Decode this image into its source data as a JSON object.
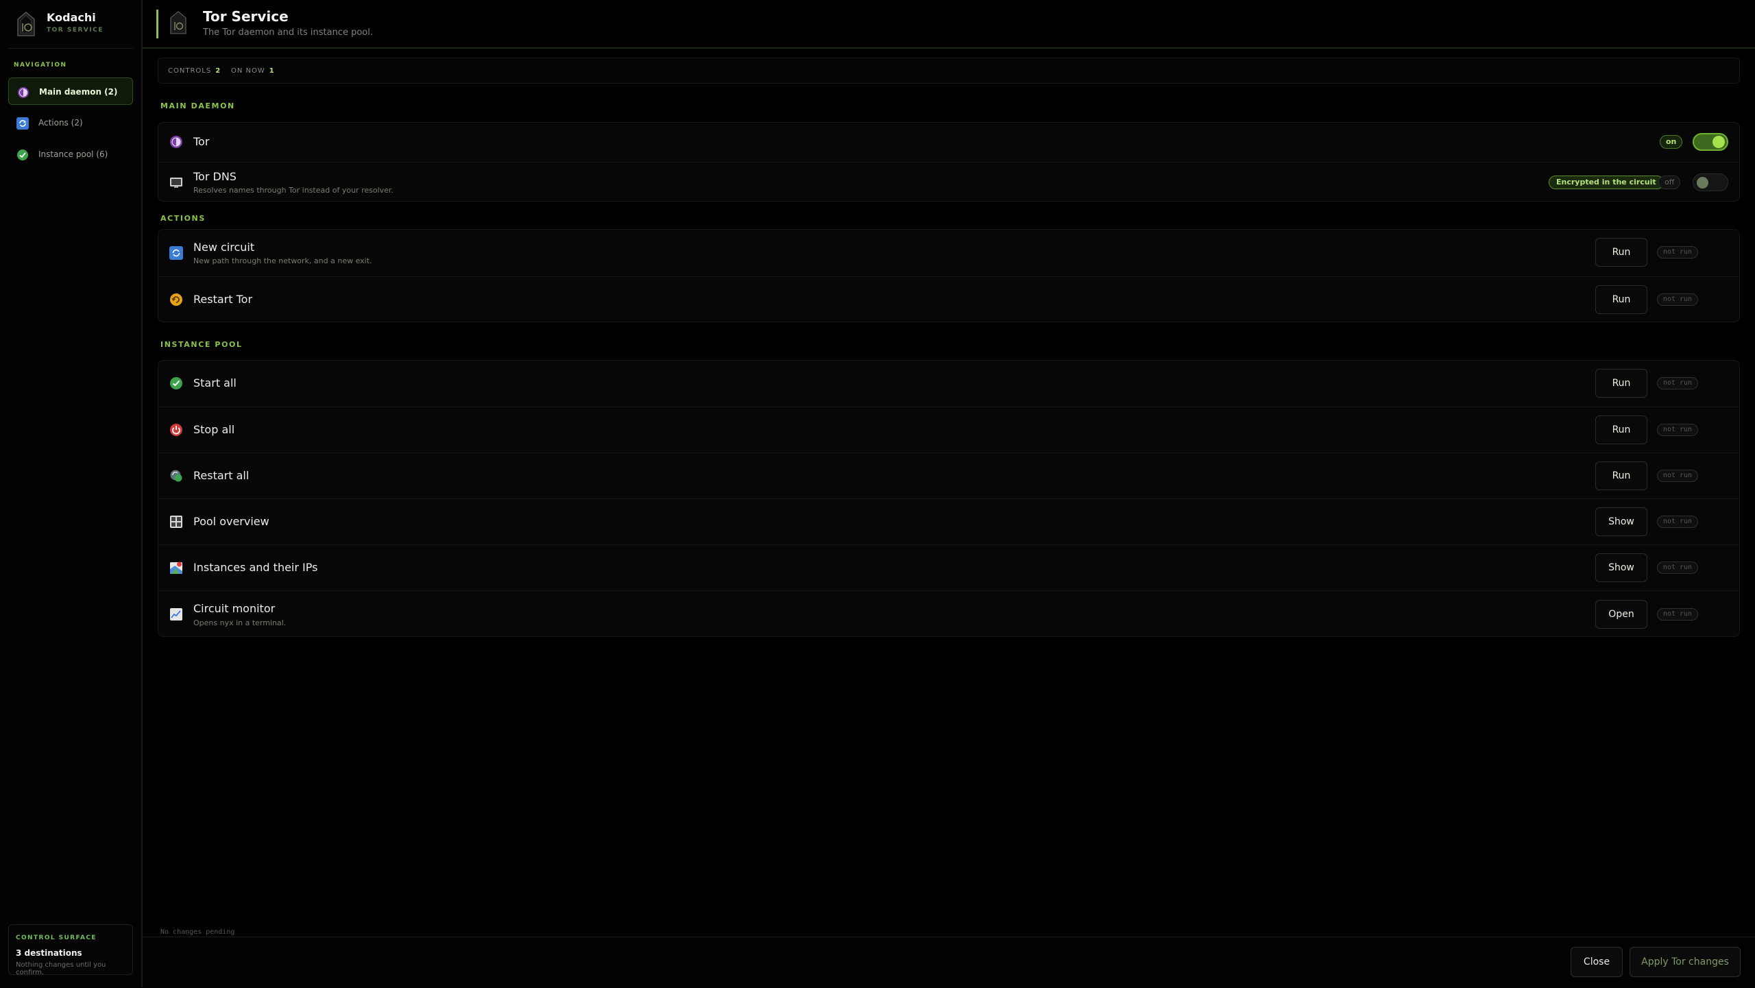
{
  "app": {
    "name": "Kodachi",
    "subtitle": "TOR SERVICE"
  },
  "sidebar": {
    "nav_heading": "NAVIGATION",
    "items": [
      {
        "label": "Main daemon (2)",
        "icon": "tor-onion-icon",
        "active": true
      },
      {
        "label": "Actions (2)",
        "icon": "refresh-icon",
        "active": false
      },
      {
        "label": "Instance pool (6)",
        "icon": "check-circle-icon",
        "active": false
      }
    ],
    "surface": {
      "heading": "CONTROL SURFACE",
      "title": "3 destinations",
      "note": "Nothing changes until you confirm."
    }
  },
  "header": {
    "title": "Tor Service",
    "subtitle": "The Tor daemon and its instance pool."
  },
  "summary": {
    "controls_label": "CONTROLS",
    "controls_value": "2",
    "on_label": "ON NOW",
    "on_value": "1"
  },
  "sections": {
    "main": {
      "heading": "MAIN DAEMON",
      "rows": [
        {
          "label": "Tor",
          "desc": "",
          "state_label": "on",
          "toggle": true
        },
        {
          "label": "Tor DNS",
          "desc": "Resolves names through Tor instead of your resolver.",
          "tag": "Encrypted in the circuit",
          "state_label": "off",
          "toggle": false
        }
      ]
    },
    "actions": {
      "heading": "ACTIONS",
      "rows": [
        {
          "label": "New circuit",
          "desc": "New path through the network, and a new exit.",
          "button": "Run",
          "status": "not run"
        },
        {
          "label": "Restart Tor",
          "desc": "",
          "button": "Run",
          "status": "not run"
        }
      ]
    },
    "pool": {
      "heading": "INSTANCE POOL",
      "rows": [
        {
          "label": "Start all",
          "desc": "",
          "button": "Run",
          "status": "not run"
        },
        {
          "label": "Stop all",
          "desc": "",
          "button": "Run",
          "status": "not run"
        },
        {
          "label": "Restart all",
          "desc": "",
          "button": "Run",
          "status": "not run"
        },
        {
          "label": "Pool overview",
          "desc": "",
          "button": "Show",
          "status": "not run"
        },
        {
          "label": "Instances and their IPs",
          "desc": "",
          "button": "Show",
          "status": "not run"
        },
        {
          "label": "Circuit monitor",
          "desc": "Opens nyx in a terminal.",
          "button": "Open",
          "status": "not run"
        }
      ]
    }
  },
  "footer": {
    "pending": "No changes pending",
    "close_label": "Close",
    "apply_label": "Apply Tor changes"
  },
  "colors": {
    "accent": "#8bc34a",
    "background": "#000000",
    "toggle_on": "#a4e34b"
  }
}
